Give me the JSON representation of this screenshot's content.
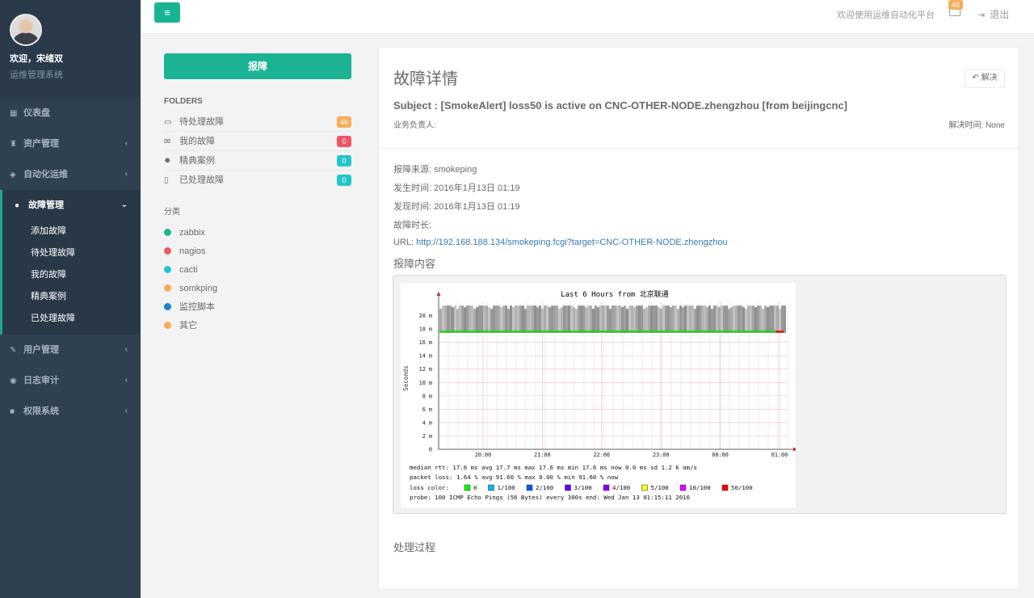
{
  "sidebar": {
    "welcome": "欢迎，宋绪双",
    "role": "运维管理系统",
    "items": [
      {
        "label": "仪表盘",
        "icon": "dashboard-icon",
        "chevron": ""
      },
      {
        "label": "资产管理",
        "icon": "assets-icon",
        "chevron": "‹"
      },
      {
        "label": "自动化运维",
        "icon": "cube-icon",
        "chevron": "‹"
      },
      {
        "label": "故障管理",
        "icon": "bomb-icon",
        "chevron": "⌄"
      },
      {
        "label": "用户管理",
        "icon": "edit-icon",
        "chevron": "‹"
      },
      {
        "label": "日志审计",
        "icon": "eye-icon",
        "chevron": "‹"
      },
      {
        "label": "权限系统",
        "icon": "briefcase-icon",
        "chevron": "‹"
      }
    ],
    "submenu": [
      "添加故障",
      "待处理故障",
      "我的故障",
      "精典案例",
      "已处理故障"
    ]
  },
  "topbar": {
    "menu_icon": "≡",
    "welcome": "欢迎使用运维自动化平台",
    "mail_count": "46",
    "logout": "退出"
  },
  "folders": {
    "report_button": "报障",
    "heading": "FOLDERS",
    "items": [
      {
        "label": "待处理故障",
        "count": "46",
        "color": "#f8ac59",
        "icon": "inbox-icon"
      },
      {
        "label": "我的故障",
        "count": "0",
        "color": "#ed5565",
        "icon": "envelope-icon"
      },
      {
        "label": "精典案例",
        "count": "0",
        "color": "#23c6c8",
        "icon": "certificate-icon"
      },
      {
        "label": "已处理故障",
        "count": "0",
        "color": "#23c6c8",
        "icon": "file-icon"
      }
    ],
    "category_heading": "分类",
    "categories": [
      {
        "label": "zabbix",
        "color": "#1ab394"
      },
      {
        "label": "nagios",
        "color": "#ed5565"
      },
      {
        "label": "cacti",
        "color": "#23c6c8"
      },
      {
        "label": "somkping",
        "color": "#f8ac59"
      },
      {
        "label": "监控脚本",
        "color": "#1c84c6"
      },
      {
        "label": "其它",
        "color": "#f8ac59"
      }
    ]
  },
  "detail": {
    "title": "故障详情",
    "resolve_button": "解决",
    "subject": "Subject : [SmokeAlert] loss50 is active on CNC-OTHER-NODE.zhengzhou [from beijingcnc]",
    "owner_label": "业务负责人:",
    "resolve_time": "解决时间: None",
    "source": "报障来源: smokeping",
    "occur_time": "发生时间: 2016年1月13日 01:19",
    "found_time": "发现时间: 2016年1月13日 01:19",
    "duration": "故障时长:",
    "url_label": "URL: ",
    "url": "http://192.168.188.134/smokeping.fcgi?target=CNC-OTHER-NODE.zhengzhou",
    "content_heading": "报障内容",
    "process_heading": "处理过程"
  },
  "chart_data": {
    "type": "line",
    "title": "Last 6 Hours from 北京联通",
    "ylabel": "Seconds",
    "ylim": [
      0,
      22
    ],
    "yticks": [
      "20 m",
      "18 m",
      "16 m",
      "14 m",
      "12 m",
      "10 m",
      "8 m",
      "6 m",
      "4 m",
      "2 m",
      "0"
    ],
    "xticks": [
      "20:00",
      "21:00",
      "22:00",
      "23:00",
      "00:00",
      "01:00"
    ],
    "median_rtt_ms": 17.6,
    "legend_lines": [
      "median rtt:  17.6 ms avg  17.7 ms max  17.6 ms min  17.6 ms now  0.0 ms sd  1.2 k am/s",
      "packet loss: 1.64 % avg  91.60 % max  0.00 % min  91.60 % now",
      "probe:       100 ICMP Echo Pings (56 Bytes) every 300s       end: Wed Jan 13 01:15:11 2016"
    ],
    "loss_color_label": "loss color:",
    "loss_colors": [
      {
        "label": "0",
        "color": "#00ff00"
      },
      {
        "label": "1/100",
        "color": "#00b8ff"
      },
      {
        "label": "2/100",
        "color": "#0059ff"
      },
      {
        "label": "3/100",
        "color": "#5e00ff"
      },
      {
        "label": "4/100",
        "color": "#7e00ff"
      },
      {
        "label": "5/100",
        "color": "#ffff00"
      },
      {
        "label": "10/100",
        "color": "#dd00ff"
      },
      {
        "label": "50/100",
        "color": "#ff0000"
      }
    ]
  }
}
